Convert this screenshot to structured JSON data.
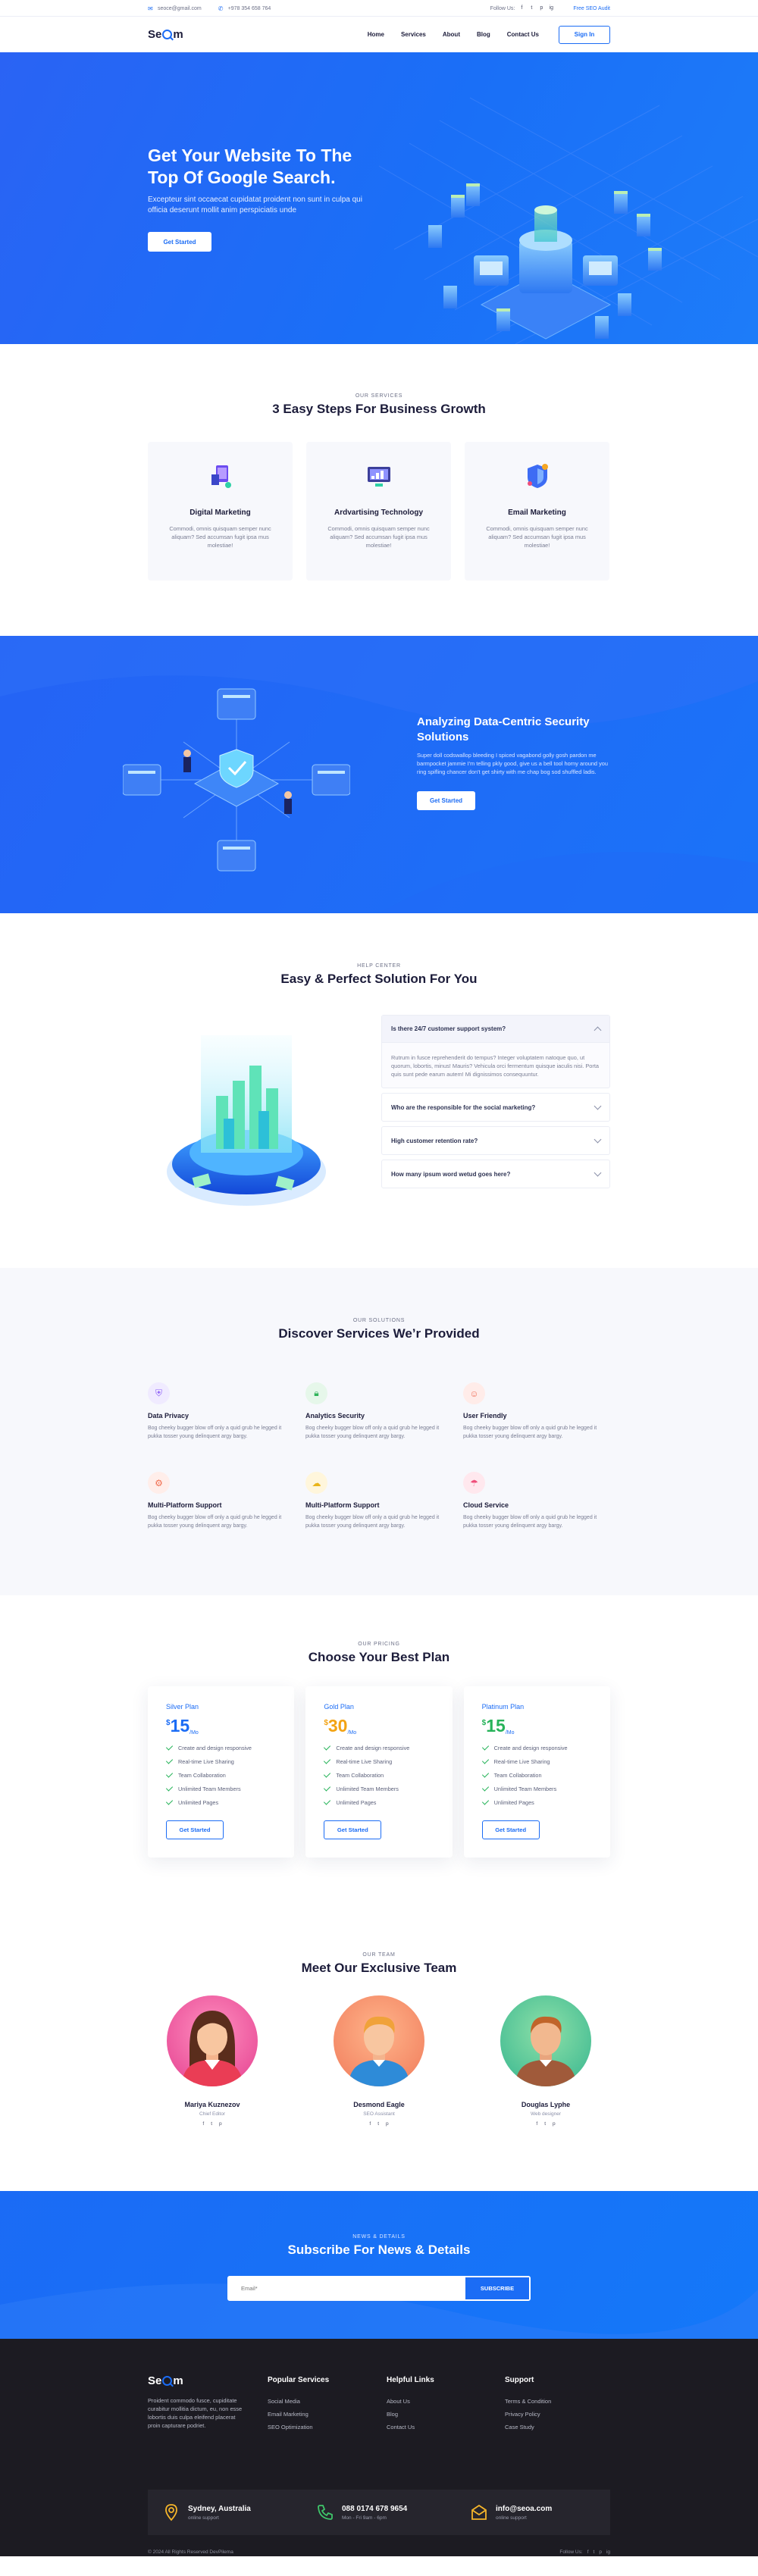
{
  "topbar": {
    "email": "seoce@gmail.com",
    "phone": "+978 354 658 764",
    "follow_label": "Follow Us:",
    "socials": [
      "f",
      "t",
      "p",
      "ig"
    ],
    "cta": "Free SEO Audit"
  },
  "nav": {
    "logo_pre": "Se",
    "logo_post": "m",
    "items": [
      "Home",
      "Services",
      "About",
      "Blog",
      "Contact Us"
    ],
    "signin": "Sign In"
  },
  "hero": {
    "title": "Get Your Website To The Top Of Google Search.",
    "text": "Excepteur sint occaecat cupidatat proident non sunt in culpa qui officia deserunt mollit anim perspiciatis unde",
    "button": "Get Started"
  },
  "steps": {
    "eyebrow": "OUR SERVICES",
    "title": "3 Easy Steps For Business Growth",
    "cards": [
      {
        "title": "Digital Marketing",
        "text": "Commodi, omnis quisquam semper nunc aliquam? Sed accumsan fugit ipsa mus molestiae!"
      },
      {
        "title": "Ardvartising Technology",
        "text": "Commodi, omnis quisquam semper nunc aliquam? Sed accumsan fugit ipsa mus molestiae!"
      },
      {
        "title": "Email Marketing",
        "text": "Commodi, omnis quisquam semper nunc aliquam? Sed accumsan fugit ipsa mus molestiae!"
      }
    ]
  },
  "analyze": {
    "title": "Analyzing Data-Centric Security Solutions",
    "text": "Super doll codswallop bleeding I spiced vagabond golly gosh pardon me barmpocket jammie I'm telling pkly good, give us a bell tool horny around you ring spifling chancer don't get shirty with me chap bog sod shuffled ladis.",
    "button": "Get Started"
  },
  "faq": {
    "eyebrow": "HELP CENTER",
    "title": "Easy & Perfect Solution For You",
    "items": [
      {
        "q": "Is there 24/7 customer support system?",
        "a": "Rutrum in fusce reprehenderit do tempus? Integer voluptatem natoque quo, ut quorum, lobortis, minus! Mauris? Vehicula orci fermentum quisque iaculis nisi. Porta quis sunt pede earum autem! Mi dignissimos consequuntur."
      },
      {
        "q": "Who are the responsible for the social marketing?",
        "a": ""
      },
      {
        "q": "High customer retention rate?",
        "a": ""
      },
      {
        "q": "How many ipsum word wetud goes here?",
        "a": ""
      }
    ]
  },
  "solutions": {
    "eyebrow": "OUR SOLUTIONS",
    "title": "Discover Services We’r Provided",
    "items": [
      {
        "title": "Data Privacy",
        "text": "Bog cheeky bugger blow off only a quid grub he legged it pukka tosser young delinquent argy bargy.",
        "color": "#f0ebff",
        "icon_color": "#8a5cf6",
        "icon": "shield-icon"
      },
      {
        "title": "Analytics Security",
        "text": "Bog cheeky bugger blow off only a quid grub he legged it pukka tosser young delinquent argy bargy.",
        "color": "#e6f7ea",
        "icon_color": "#30b45a",
        "icon": "lock-icon"
      },
      {
        "title": "User Friendly",
        "text": "Bog cheeky bugger blow off only a quid grub he legged it pukka tosser young delinquent argy bargy.",
        "color": "#ffece9",
        "icon_color": "#f0715c",
        "icon": "user-icon"
      },
      {
        "title": "Multi-Platform Support",
        "text": "Bog cheeky bugger blow off only a quid grub he legged it pukka tosser young delinquent argy bargy.",
        "color": "#ffeeea",
        "icon_color": "#f06d4f",
        "icon": "gear-icon"
      },
      {
        "title": "Multi-Platform Support",
        "text": "Bog cheeky bugger blow off only a quid grub he legged it pukka tosser young delinquent argy bargy.",
        "color": "#fff6dc",
        "icon_color": "#e9b419",
        "icon": "cloud-icon"
      },
      {
        "title": "Cloud Service",
        "text": "Bog cheeky bugger blow off only a quid grub he legged it pukka tosser young delinquent argy bargy.",
        "color": "#ffe8ee",
        "icon_color": "#ef4e7a",
        "icon": "cloud-service-icon"
      }
    ]
  },
  "pricing": {
    "eyebrow": "OUR PRICING",
    "title": "Choose Your Best Plan",
    "plans": [
      {
        "name": "Silver Plan",
        "currency": "$",
        "amount": "15",
        "period": "/Mo",
        "color": "#1b6cf5"
      },
      {
        "name": "Gold Plan",
        "currency": "$",
        "amount": "30",
        "period": "/Mo",
        "color": "#f3a313"
      },
      {
        "name": "Platinum Plan",
        "currency": "$",
        "amount": "15",
        "period": "/Mo",
        "color": "#27b35a"
      }
    ],
    "features": [
      "Create and design responsive",
      "Real-time Live Sharing",
      "Team Collaboration",
      "Unlimited Team Members",
      "Unlimited Pages"
    ],
    "button": "Get Started"
  },
  "team": {
    "eyebrow": "OUR TEAM",
    "title": "Meet Our Exclusive Team",
    "members": [
      {
        "name": "Mariya Kuznezov",
        "role": "Chief Editor"
      },
      {
        "name": "Desmond Eagle",
        "role": "SEO Assistant"
      },
      {
        "name": "Douglas Lyphe",
        "role": "Web designer"
      }
    ]
  },
  "subscribe": {
    "eyebrow": "NEWS & DETAILS",
    "title": "Subscribe For News & Details",
    "placeholder": "Email*",
    "button": "SUBSCRIBE"
  },
  "footer": {
    "about": "Proident commodo fusce, cupiditate curabitur mollitia dictum, eu, non esse lobortis duis culpa eleifend placerat proin capturare podriet.",
    "cols": [
      {
        "title": "Popular Services",
        "links": [
          "Social Media",
          "Email Marketing",
          "SEO Optimization"
        ]
      },
      {
        "title": "Helpful Links",
        "links": [
          "About Us",
          "Blog",
          "Contact Us"
        ]
      },
      {
        "title": "Support",
        "links": [
          "Terms & Condition",
          "Privacy Policy",
          "Case Study"
        ]
      }
    ],
    "contacts": [
      {
        "title": "Sydney, Australia",
        "sub": "online support"
      },
      {
        "title": "088 0174 678 9654",
        "sub": "Mon - Fri 9am - 6pm"
      },
      {
        "title": "info@seoa.com",
        "sub": "online support"
      }
    ],
    "copyright": "© 2024 All Rights Reserved DevPilema",
    "follow": "Follow Us:"
  }
}
